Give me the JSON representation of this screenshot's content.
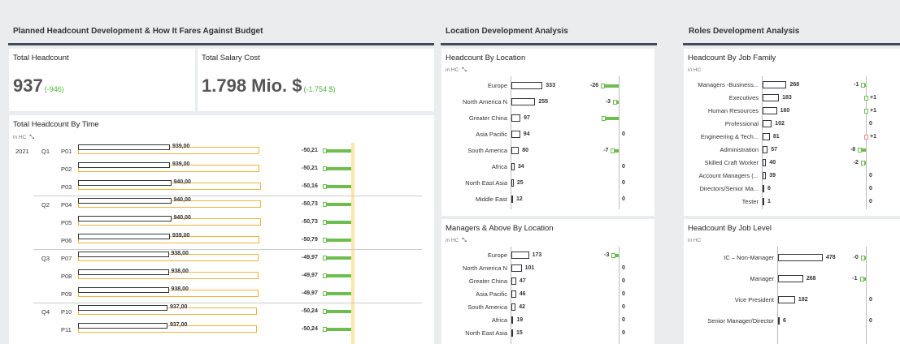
{
  "sections": {
    "planned": "Planned Headcount Development & How It Fares Against Budget",
    "location": "Location Development Analysis",
    "roles": "Roles Development Analysis"
  },
  "kpis": {
    "headcount": {
      "title": "Total Headcount",
      "value": "937",
      "delta": "(-946)"
    },
    "salary": {
      "title": "Total Salary Cost",
      "value": "1.798 Mio. $",
      "delta": "(-1.754 $)"
    }
  },
  "unit": "in HC",
  "time": {
    "title": "Total Headcount By Time",
    "year": "2021",
    "rows": [
      {
        "q": "Q1",
        "p": "P01",
        "actual": "939,00",
        "actual_n": 939,
        "var": "-50,21",
        "var_n": 50.21
      },
      {
        "q": "",
        "p": "P02",
        "actual": "939,00",
        "actual_n": 939,
        "var": "-50,21",
        "var_n": 50.21
      },
      {
        "q": "",
        "p": "P03",
        "actual": "940,00",
        "actual_n": 940,
        "var": "-50,16",
        "var_n": 50.16
      },
      {
        "q": "Q2",
        "p": "P04",
        "actual": "940,00",
        "actual_n": 940,
        "var": "-50,73",
        "var_n": 50.73
      },
      {
        "q": "",
        "p": "P05",
        "actual": "940,00",
        "actual_n": 940,
        "var": "-50,73",
        "var_n": 50.73
      },
      {
        "q": "",
        "p": "P06",
        "actual": "939,00",
        "actual_n": 939,
        "var": "-50,79",
        "var_n": 50.79
      },
      {
        "q": "Q3",
        "p": "P07",
        "actual": "938,00",
        "actual_n": 938,
        "var": "-49,97",
        "var_n": 49.97
      },
      {
        "q": "",
        "p": "P08",
        "actual": "938,00",
        "actual_n": 938,
        "var": "-49,97",
        "var_n": 49.97
      },
      {
        "q": "",
        "p": "P09",
        "actual": "938,00",
        "actual_n": 938,
        "var": "-49,97",
        "var_n": 49.97
      },
      {
        "q": "Q4",
        "p": "P10",
        "actual": "937,00",
        "actual_n": 937,
        "var": "-50,24",
        "var_n": 50.24
      },
      {
        "q": "",
        "p": "P11",
        "actual": "937,00",
        "actual_n": 937,
        "var": "-50,24",
        "var_n": 50.24
      }
    ]
  },
  "hc_location": {
    "title": "Headcount By Location",
    "rows": [
      {
        "label": "Europe",
        "value": 333,
        "var": "-26",
        "var_n": -26
      },
      {
        "label": "North America N",
        "value": 255,
        "var": "-3",
        "var_n": -3
      },
      {
        "label": "Greater China",
        "value": 97,
        "var": "",
        "var_n": -24
      },
      {
        "label": "Asia Pacific",
        "value": 94,
        "var": "0",
        "var_n": 0
      },
      {
        "label": "South America",
        "value": 80,
        "var": "-7",
        "var_n": -7
      },
      {
        "label": "Africa",
        "value": 34,
        "var": "0",
        "var_n": 0
      },
      {
        "label": "North East Asia",
        "value": 25,
        "var": "0",
        "var_n": 0
      },
      {
        "label": "Middle East",
        "value": 12,
        "var": "0",
        "var_n": 0
      }
    ]
  },
  "mgr_location": {
    "title": "Managers & Above By Location",
    "rows": [
      {
        "label": "Europe",
        "value": 173,
        "var": "-3",
        "var_n": -3
      },
      {
        "label": "North America N",
        "value": 101,
        "var": "0",
        "var_n": 0
      },
      {
        "label": "Greater China",
        "value": 47,
        "var": "0",
        "var_n": 0
      },
      {
        "label": "Asia Pacific",
        "value": 46,
        "var": "0",
        "var_n": 0
      },
      {
        "label": "South America",
        "value": 42,
        "var": "0",
        "var_n": 0
      },
      {
        "label": "Africa",
        "value": 19,
        "var": "0",
        "var_n": 0
      },
      {
        "label": "North East Asia",
        "value": 15,
        "var": "0",
        "var_n": 0
      }
    ]
  },
  "job_family": {
    "title": "Headcount By Job Family",
    "rows": [
      {
        "label": "Managers -Business...",
        "value": 268,
        "var": "-1",
        "var_n": -1
      },
      {
        "label": "Executives",
        "value": 183,
        "var": "+1",
        "var_n": 1
      },
      {
        "label": "Human Resources",
        "value": 160,
        "var": "+1",
        "var_n": 1
      },
      {
        "label": "Professional",
        "value": 102,
        "var": "0",
        "var_n": 0
      },
      {
        "label": "Engineering & Tech...",
        "value": 81,
        "var": "+1",
        "var_n": 1,
        "red": true
      },
      {
        "label": "Administration",
        "value": 57,
        "var": "-8",
        "var_n": -8
      },
      {
        "label": "Skilled Craft Worker",
        "value": 40,
        "var": "-2",
        "var_n": -2
      },
      {
        "label": "Account Managers (...",
        "value": 39,
        "var": "0",
        "var_n": 0
      },
      {
        "label": "Directors/Senior Ma...",
        "value": 6,
        "var": "0",
        "var_n": 0
      },
      {
        "label": "Tester",
        "value": 1,
        "var": "0",
        "var_n": 0
      }
    ]
  },
  "job_level": {
    "title": "Headcount By Job Level",
    "rows": [
      {
        "label": "IC – Non-Manager",
        "value": 478,
        "var": "-0",
        "var_n": -0.5
      },
      {
        "label": "Manager",
        "value": 268,
        "var": "-1",
        "var_n": -1
      },
      {
        "label": "Vice President",
        "value": 182,
        "var": "0",
        "var_n": 0
      },
      {
        "label": "Senior Manager/Director",
        "value": 6,
        "var": "0",
        "var_n": 0
      }
    ]
  }
}
